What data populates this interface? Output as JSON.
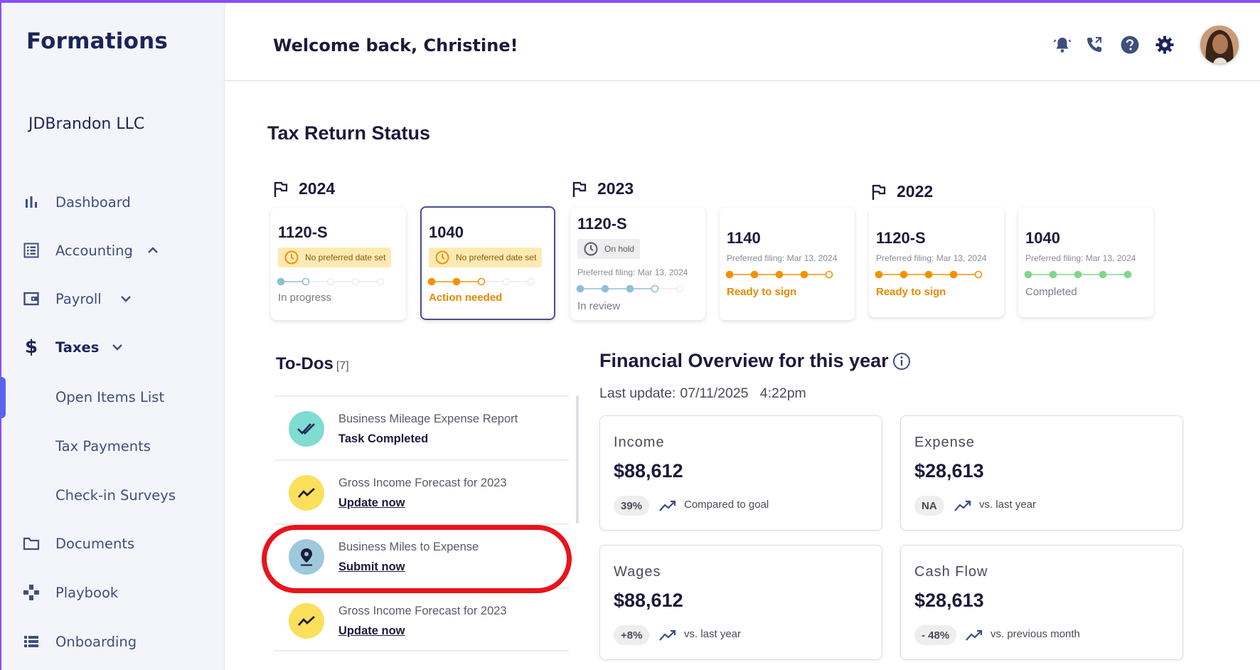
{
  "app": {
    "logo": "Formations",
    "company": "JDBrandon LLC"
  },
  "header": {
    "welcome": "Welcome back, Christine!"
  },
  "sidebar": {
    "items": [
      {
        "label": "Dashboard",
        "icon": "bar-chart-icon"
      },
      {
        "label": "Accounting",
        "icon": "ledger-icon",
        "chevron": "up"
      },
      {
        "label": "Payroll",
        "icon": "wallet-icon",
        "chevron": "down"
      },
      {
        "label": "Taxes",
        "icon": "dollar-icon",
        "chevron": "down",
        "active": true
      },
      {
        "label": "Documents",
        "icon": "folder-icon"
      },
      {
        "label": "Playbook",
        "icon": "gamepad-icon"
      },
      {
        "label": "Onboarding",
        "icon": "list-icon"
      }
    ],
    "sub_items": [
      {
        "label": "Open Items List",
        "active": true
      },
      {
        "label": "Tax Payments"
      },
      {
        "label": "Check-in Surveys"
      }
    ]
  },
  "tax_status": {
    "title": "Tax Return Status",
    "years": [
      "2024",
      "2023",
      "2022"
    ],
    "cards": [
      {
        "form": "1120-S",
        "badge": "No preferred date set",
        "status": "In progress",
        "steps_done": 2,
        "steps_total": 5
      },
      {
        "form": "1040",
        "badge": "No preferred date set",
        "status": "Action needed",
        "steps_done": 3,
        "steps_total": 5
      },
      {
        "form": "1120-S",
        "badge": "On hold",
        "pref": "Preferred filing: Mar 13, 2024",
        "status": "In review",
        "steps_done": 4,
        "steps_total": 5
      },
      {
        "form": "1140",
        "pref": "Preferred filing: Mar 13, 2024",
        "status": "Ready to sign",
        "steps_done": 5,
        "steps_total": 5
      },
      {
        "form": "1120-S",
        "pref": "Preferred filing: Mar 13, 2024",
        "status": "Ready to sign",
        "steps_done": 5,
        "steps_total": 5
      },
      {
        "form": "1040",
        "pref": "Preferred filing: Mar 13, 2024",
        "status": "Completed",
        "steps_done": 5,
        "steps_total": 5
      }
    ]
  },
  "todos": {
    "title": "To-Dos",
    "count": "[7]",
    "items": [
      {
        "title": "Business Mileage Expense Report",
        "sub": "Task Completed",
        "icon": "double-check-icon"
      },
      {
        "title": "Gross Income Forecast for 2023",
        "sub": "Update now",
        "icon": "trend-icon"
      },
      {
        "title": "Business Miles to Expense",
        "sub": "Submit now",
        "icon": "location-pin-icon"
      },
      {
        "title": "Gross Income Forecast for 2023",
        "sub": "Update now",
        "icon": "trend-icon"
      }
    ]
  },
  "financial": {
    "title": "Financial Overview for this year",
    "last_update_label": "Last update:",
    "last_update_value": "07/11/2025   4:22pm",
    "cards": [
      {
        "label": "Income",
        "value": "$88,612",
        "pill": "39%",
        "note": "Compared to goal"
      },
      {
        "label": "Expense",
        "value": "$28,613",
        "pill": "NA",
        "note": "vs. last year"
      },
      {
        "label": "Wages",
        "value": "$88,612",
        "pill": "+8%",
        "note": "vs. last year"
      },
      {
        "label": "Cash Flow",
        "value": "$28,613",
        "pill": "- 48%",
        "note": "vs. previous month"
      }
    ]
  },
  "colors": {
    "accent": "#5a63f0",
    "navy": "#1c2559",
    "orange": "#f39200",
    "green": "#7ed88a",
    "highlight_ring": "#e8141c"
  }
}
